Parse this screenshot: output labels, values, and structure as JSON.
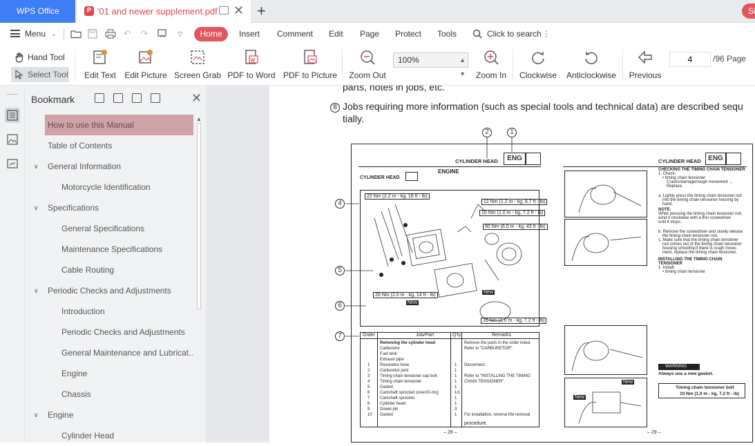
{
  "app": {
    "home_tab": "WPS Office"
  },
  "document_tab": {
    "title": "'01 and newer supplement.pdf",
    "pdf_badge": "P"
  },
  "user": {
    "avatar_text": "Si"
  },
  "menubar": {
    "menu_label": "Menu",
    "tabs": [
      "Home",
      "Insert",
      "Comment",
      "Edit",
      "Page",
      "Protect",
      "Tools"
    ],
    "search_label": "Click to search"
  },
  "toolbar": {
    "hand_tool": "Hand Tool",
    "select_tool": "Select Tool",
    "edit_text": "Edit Text",
    "edit_picture": "Edit Picture",
    "screen_grab": "Screen Grab",
    "pdf_to_word": "PDF to Word",
    "pdf_to_picture": "PDF to Picture",
    "zoom_out": "Zoom Out",
    "zoom_value": "100%",
    "zoom_in": "Zoom In",
    "clockwise": "Clockwise",
    "anticlockwise": "Anticlockwise",
    "previous": "Previous",
    "page_current": "4",
    "page_total": "/96 Page"
  },
  "bookmark": {
    "title": "Bookmark",
    "items": [
      {
        "label": "How to use this Manual",
        "level": 0,
        "selected": true
      },
      {
        "label": "Table of Contents",
        "level": 0
      },
      {
        "label": "General Information",
        "level": 0,
        "expanded": true
      },
      {
        "label": "Motorcycle Identification",
        "level": 1
      },
      {
        "label": "Specifications",
        "level": 0,
        "expanded": true
      },
      {
        "label": "General Specifications",
        "level": 1
      },
      {
        "label": "Maintenance Specifications",
        "level": 1
      },
      {
        "label": "Cable Routing",
        "level": 1
      },
      {
        "label": "Periodic Checks and Adjustments",
        "level": 0,
        "expanded": true
      },
      {
        "label": "Introduction",
        "level": 1
      },
      {
        "label": "Periodic Checks and Adjustments",
        "level": 1
      },
      {
        "label": "General Maintenance and Lubricat..",
        "level": 1
      },
      {
        "label": "Engine",
        "level": 1
      },
      {
        "label": "Chassis",
        "level": 1
      },
      {
        "label": "Engine",
        "level": 0,
        "expanded": true
      },
      {
        "label": "Cylinder Head",
        "level": 1
      }
    ]
  },
  "document": {
    "line_top": "parts, notes in jobs, etc.",
    "item8_number": "8",
    "item8_text": "Jobs requiring more information (such as special tools and technical data) are described sequ",
    "item8_cont": "tially.",
    "figure": {
      "callouts": [
        "2",
        "1",
        "4",
        "5",
        "6",
        "7"
      ],
      "left_header": "CYLINDER HEAD",
      "left_section": "ENGINE",
      "left_subtitle": "CYLINDER HEAD",
      "badge": "ENG",
      "right_header": "CYLINDER HEAD",
      "torque_1": "22 Nm (2.2 m - kg, 16 ft - lb)",
      "torque_2": "12 Nm (1.2 m - kg, 8.7 ft - lb)",
      "torque_3": "10 Nm (1.0 m - kg, 7.2 ft - lb)",
      "torque_4": "60 Nm (6.0 m - kg, 43 ft - lb)",
      "torque_5": "20 Nm (2.0 m - kg, 14 ft - lb)",
      "torque_6": "10 Nm (1.0 m - kg, 7.2 ft - lb)",
      "new_label": "New",
      "table_headers": [
        "Order",
        "Job/Part",
        "Q'ty",
        "Remarks"
      ],
      "table_rows": [
        [
          "",
          "Removing the cylinder head",
          "",
          "Remove the parts in the order listed."
        ],
        [
          "",
          "Carburetor",
          "",
          "Refer to \"CARBURETOR\"."
        ],
        [
          "",
          "Fuel tank",
          "",
          ""
        ],
        [
          "",
          "Exhaust pipe",
          "",
          ""
        ],
        [
          "1",
          "Resonator hose",
          "1",
          "Disconnect."
        ],
        [
          "2",
          "Carburetor joint",
          "1",
          ""
        ],
        [
          "3",
          "Timing chain tensioner cap bolt",
          "1",
          "Refer to \"INSTALLING THE TIMING"
        ],
        [
          "4",
          "Timing chain tensioner",
          "1",
          "CHAIN TENSIONER\"."
        ],
        [
          "5",
          "Gasket",
          "1",
          ""
        ],
        [
          "6",
          "Camshaft sprocket cover/O-ring",
          "1/1",
          ""
        ],
        [
          "7",
          "Camshaft sprocket",
          "1",
          ""
        ],
        [
          "8",
          "Cylinder head",
          "1",
          ""
        ],
        [
          "9",
          "Dowel pin",
          "3",
          ""
        ],
        [
          "10",
          "Gasket",
          "1",
          "For installation, reverse the removal"
        ]
      ],
      "table_last_remark": "procedure.",
      "page_left": "– 28 –",
      "page_right": "– 29 –",
      "right_col": {
        "check_title": "CHECKING THE TIMING CHAIN TENSIONER",
        "check_1": "1. Check:",
        "check_1a": "• timing chain tensioner",
        "check_1b": "Cracks/damage/rough movement →",
        "check_1c": "Replace.",
        "step_a": "a. Lightly press the timing chain tensioner rod",
        "step_a2": "into the timing chain tensioner housing by",
        "step_a3": "hand.",
        "note_title": "NOTE:",
        "note_1": "While pressing the timing chain tensioner rod,",
        "note_2": "wind it clockwise with a thin screwdriver",
        "note_3": "until it stops.",
        "step_b": "b. Remove the screwdriver and slowly release",
        "step_b2": "the timing chain tensioner rod.",
        "step_c": "c. Make sure that the timing chain tensioner",
        "step_c2": "rod comes out of the timing chain tensioner",
        "step_c3": "housing smoothly.If there is rough move-",
        "step_c4": "ment, replace the timing chain tensioner.",
        "install_title": "INSTALLING THE TIMING CHAIN",
        "install_title2": "TENSIONER",
        "install_1": "1. Install:",
        "install_1a": "• timing chain tensioner",
        "warning": "WARNING",
        "warning_text": "Always use a new gasket.",
        "bolt_title": "Timing chain tensioner bolt",
        "bolt_value": "10 Nm (1.0 m - kg, 7.2 ft - lb)"
      }
    }
  }
}
